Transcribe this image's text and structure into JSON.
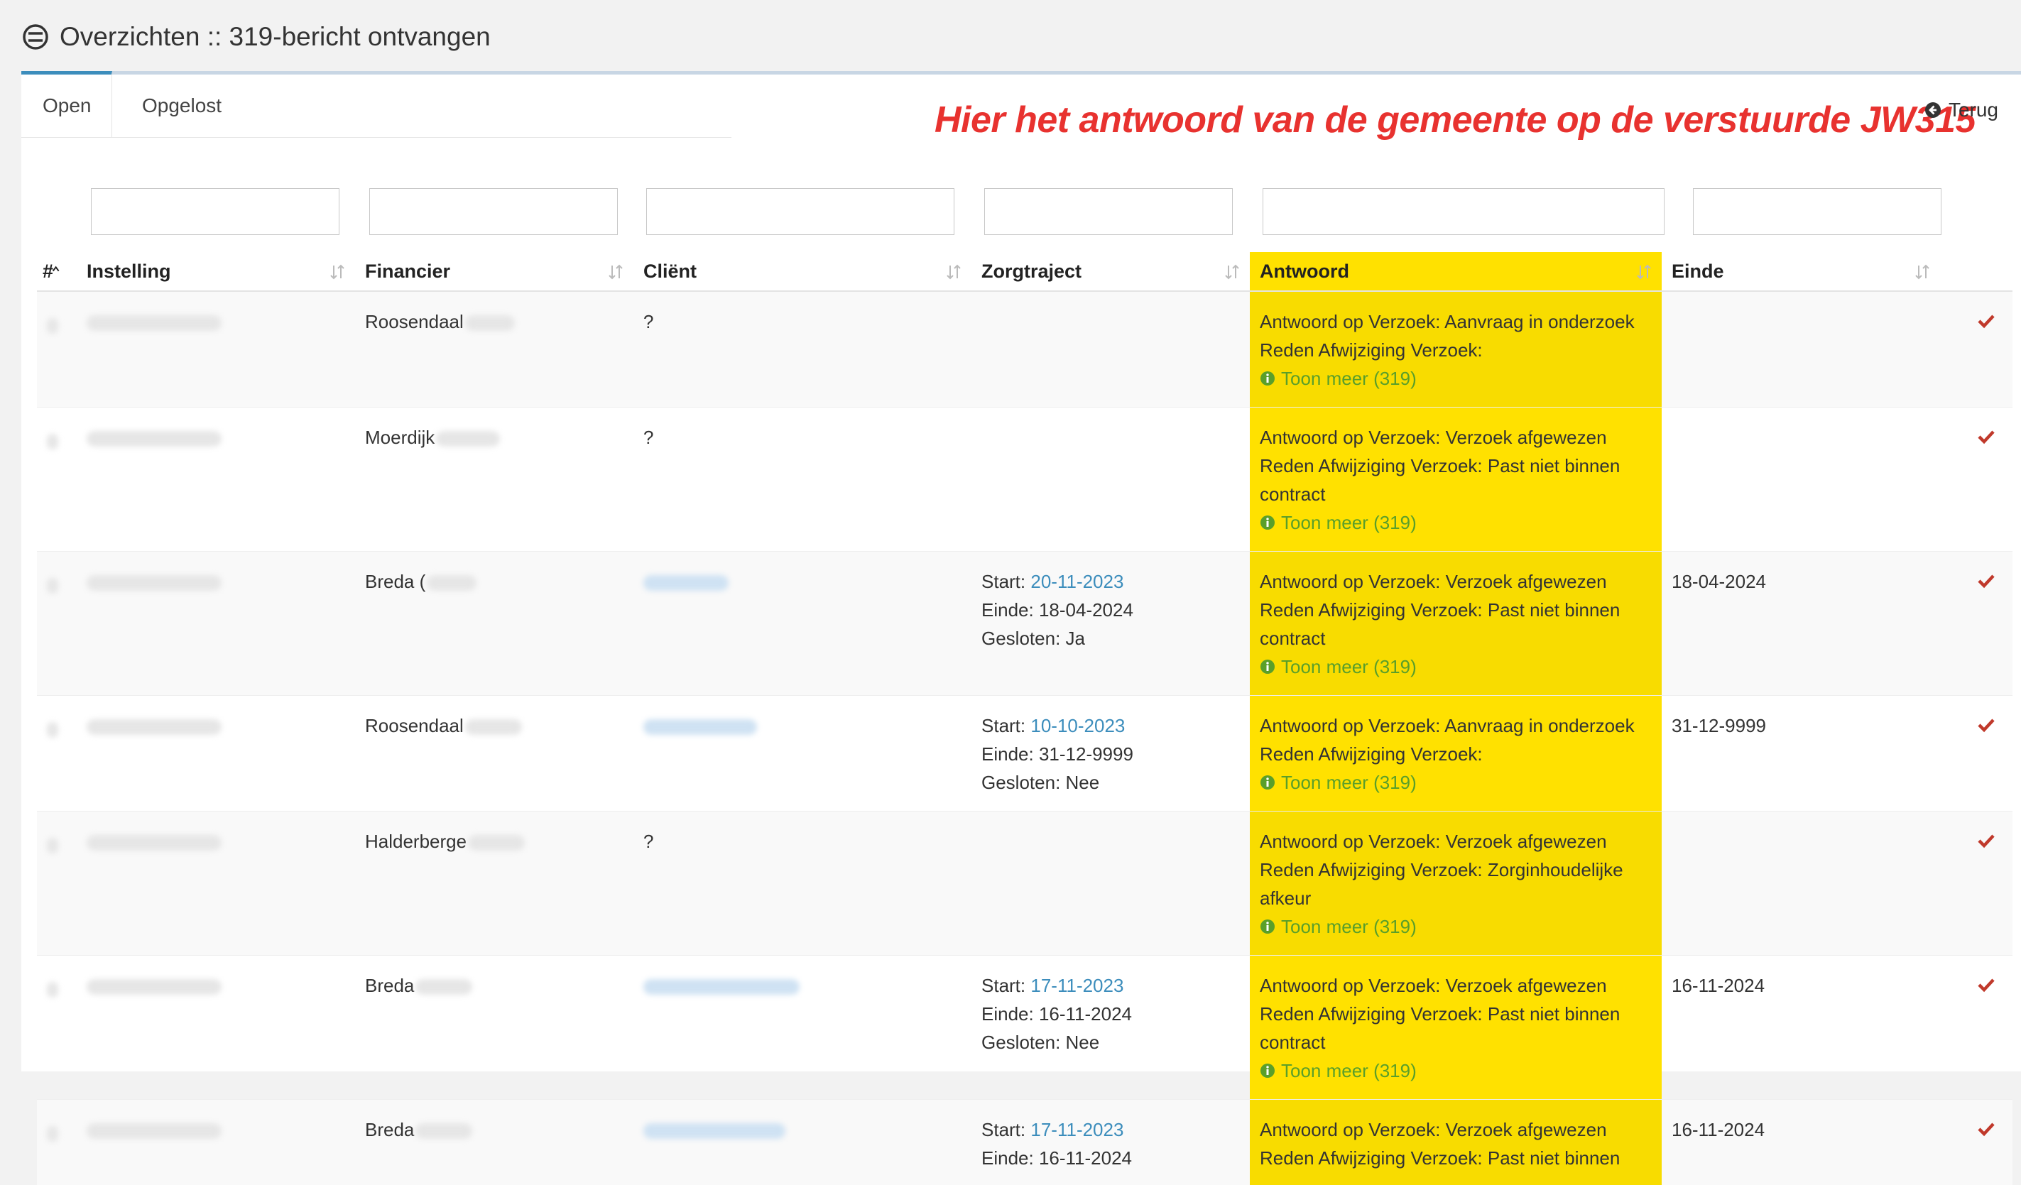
{
  "header": {
    "title": "Overzichten :: 319-bericht ontvangen",
    "icon": "no-entry-icon"
  },
  "tabs": [
    {
      "label": "Open",
      "active": true
    },
    {
      "label": "Opgelost",
      "active": false
    }
  ],
  "annotation": "Hier het antwoord van de gemeente op de verstuurde JW315",
  "back_link": {
    "label": "Terug",
    "icon": "circle-arrow-left-icon"
  },
  "filters": {
    "placeholders": [
      "",
      "",
      "",
      "",
      "",
      ""
    ]
  },
  "table": {
    "columns": [
      {
        "label": "#"
      },
      {
        "label": "Instelling"
      },
      {
        "label": "Financier"
      },
      {
        "label": "Cliënt"
      },
      {
        "label": "Zorgtraject"
      },
      {
        "label": "Antwoord"
      },
      {
        "label": "Einde"
      },
      {
        "label": ""
      }
    ],
    "highlight_color": "#ffe100",
    "link_color": "#3c8dbc",
    "more_color": "#5a9f2a",
    "check_color": "#c0392b",
    "rows": [
      {
        "financier": "Roosendaal",
        "client": "?",
        "zorgtraject": null,
        "antwoord": {
          "line1": "Antwoord op Verzoek: Aanvraag in onderzoek",
          "line2": "Reden Afwijziging Verzoek:"
        },
        "more": "Toon meer (319)",
        "einde": ""
      },
      {
        "financier": "Moerdijk",
        "client": "?",
        "zorgtraject": null,
        "antwoord": {
          "line1": "Antwoord op Verzoek: Verzoek afgewezen",
          "line2": "Reden Afwijziging Verzoek: Past niet binnen contract"
        },
        "more": "Toon meer (319)",
        "einde": ""
      },
      {
        "financier": "Breda (",
        "client": "",
        "zorgtraject": {
          "start_label": "Start:",
          "start": "20-11-2023",
          "einde": "Einde: 18-04-2024",
          "gesloten": "Gesloten: Ja"
        },
        "antwoord": {
          "line1": "Antwoord op Verzoek: Verzoek afgewezen",
          "line2": "Reden Afwijziging Verzoek: Past niet binnen contract"
        },
        "more": "Toon meer (319)",
        "einde": "18-04-2024"
      },
      {
        "financier": "Roosendaal",
        "client": "",
        "zorgtraject": {
          "start_label": "Start:",
          "start": "10-10-2023",
          "einde": "Einde: 31-12-9999",
          "gesloten": "Gesloten: Nee"
        },
        "antwoord": {
          "line1": "Antwoord op Verzoek: Aanvraag in onderzoek",
          "line2": "Reden Afwijziging Verzoek:"
        },
        "more": "Toon meer (319)",
        "einde": "31-12-9999"
      },
      {
        "financier": "Halderberge",
        "client": "?",
        "zorgtraject": null,
        "antwoord": {
          "line1": "Antwoord op Verzoek: Verzoek afgewezen",
          "line2": "Reden Afwijziging Verzoek: Zorginhoudelijke afkeur"
        },
        "more": "Toon meer (319)",
        "einde": ""
      },
      {
        "financier": "Breda",
        "client": "",
        "zorgtraject": {
          "start_label": "Start:",
          "start": "17-11-2023",
          "einde": "Einde: 16-11-2024",
          "gesloten": "Gesloten: Nee"
        },
        "antwoord": {
          "line1": "Antwoord op Verzoek: Verzoek afgewezen",
          "line2": "Reden Afwijziging Verzoek: Past niet binnen contract"
        },
        "more": "Toon meer (319)",
        "einde": "16-11-2024"
      },
      {
        "financier": "Breda",
        "client": "",
        "zorgtraject": {
          "start_label": "Start:",
          "start": "17-11-2023",
          "einde": "Einde: 16-11-2024",
          "gesloten": ""
        },
        "antwoord": {
          "line1": "Antwoord op Verzoek: Verzoek afgewezen",
          "line2": "Reden Afwijziging Verzoek: Past niet binnen"
        },
        "more": "",
        "einde": "16-11-2024"
      }
    ]
  }
}
